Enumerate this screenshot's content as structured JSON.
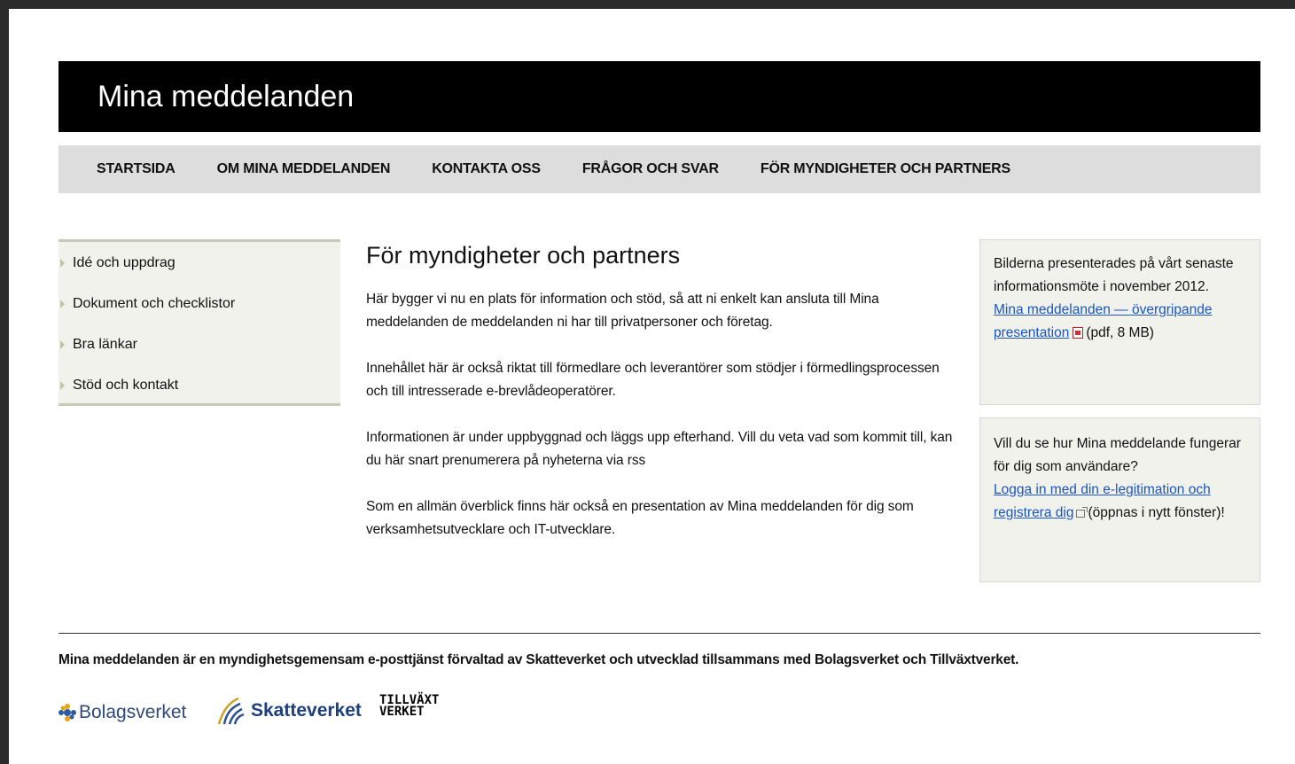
{
  "site": {
    "title": "Mina meddelanden"
  },
  "topnav": {
    "items": [
      {
        "label": "STARTSIDA"
      },
      {
        "label": "OM MINA MEDDELANDEN"
      },
      {
        "label": "KONTAKTA OSS"
      },
      {
        "label": "FRÅGOR OCH SVAR"
      },
      {
        "label": "FÖR MYNDIGHETER OCH PARTNERS"
      }
    ]
  },
  "sidenav": {
    "items": [
      {
        "label": "Idé och uppdrag"
      },
      {
        "label": "Dokument och checklistor"
      },
      {
        "label": "Bra länkar"
      },
      {
        "label": "Stöd och kontakt"
      }
    ]
  },
  "main": {
    "heading": "För myndigheter och partners",
    "paragraphs": [
      "Här bygger vi nu en plats för information och stöd, så att ni enkelt kan ansluta till Mina meddelanden de meddelanden ni har till privatpersoner och företag.",
      "Innehållet här är också riktat till förmedlare och leverantörer som stödjer i förmedlingsprocessen och till intresserade e-brevlådeoperatörer.",
      "Informationen är under uppbyggnad och läggs upp efterhand. Vill du veta vad som kommit till, kan du här snart prenumerera på nyheterna via rss",
      "Som en allmän överblick finns här också en presentation av Mina meddelanden för dig som verksamhetsutvecklare och IT-utvecklare."
    ]
  },
  "sidebar": {
    "box1": {
      "text": "Bilderna presenterades på vårt senaste informationsmöte i november 2012.",
      "link": "Mina meddelanden — övergripande presentation",
      "suffix": "(pdf, 8 MB)"
    },
    "box2": {
      "text": "Vill du se hur Mina meddelande fungerar för dig som användare?",
      "link": "Logga in med din e-legitimation och registrera dig",
      "suffix": "(öppnas i nytt fönster)!"
    }
  },
  "footer": {
    "text": "Mina meddelanden är en myndighetsgemensam e-posttjänst förvaltad av Skatteverket och utvecklad tillsammans med Bolagsverket och Tillväxtverket.",
    "logos": {
      "bolagsverket": "Bolagsverket",
      "skatteverket": "Skatteverket",
      "tillvaxtverket_line1": "TILLVÄXT",
      "tillvaxtverket_line2": "VERKET"
    }
  },
  "colors": {
    "masthead": "#000000",
    "nav_bg": "#dddddd",
    "sidenav_bg": "#f2f2ec",
    "link": "#1a55c4"
  },
  "icons": [
    "pdf-icon",
    "external-link-icon",
    "arrow-icon",
    "bolagsverket-logo",
    "skatteverket-logo",
    "tillvaxtverket-logo"
  ]
}
